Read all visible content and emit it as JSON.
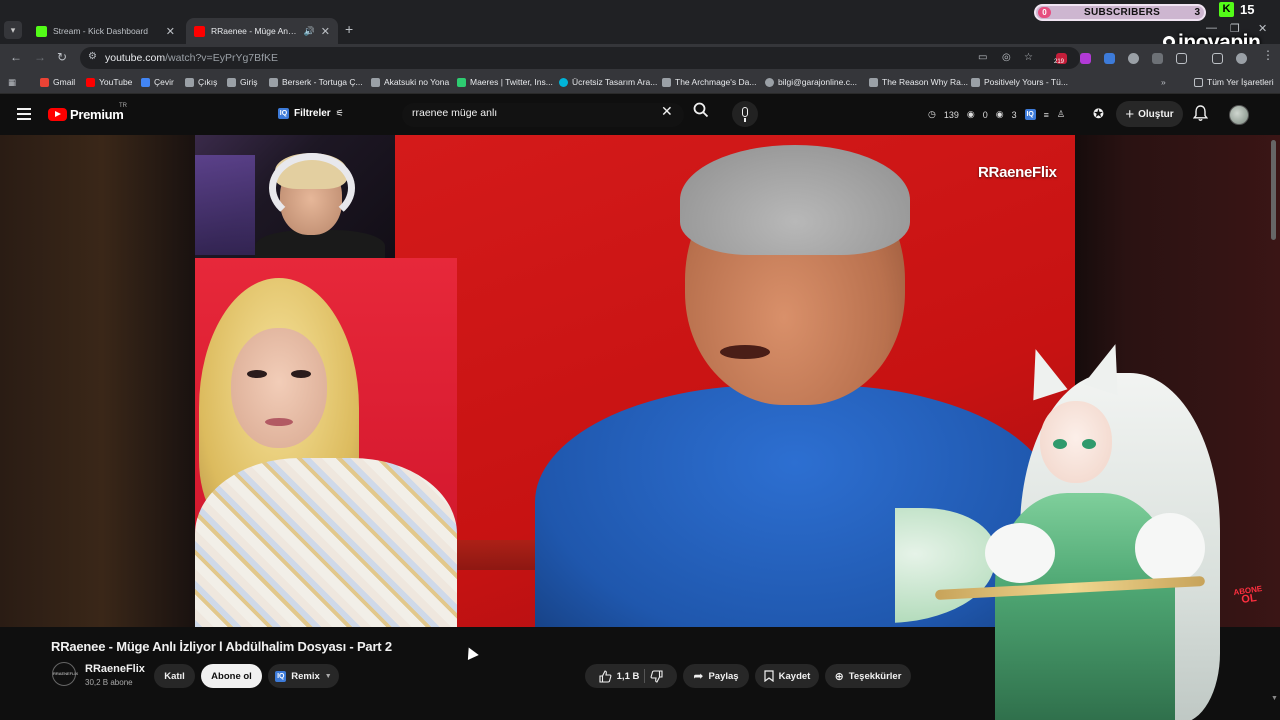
{
  "browser": {
    "tabs": [
      {
        "title": "Stream - Kick Dashboard",
        "favicon_color": "#53fc18",
        "active": false
      },
      {
        "title": "RRaenee - Müge Anlı İzliyor",
        "favicon_color": "#ff0000",
        "active": true
      }
    ],
    "url": "youtube.com/watch?v=EyPrYg7BfKE",
    "url_host": "youtube.com",
    "url_path": "/watch?v=EyPrYg7BfKE",
    "extension_badge": "219",
    "bookmarks": [
      {
        "label": "Gmail",
        "icon_color": "#ea4335"
      },
      {
        "label": "YouTube",
        "icon_color": "#ff0000"
      },
      {
        "label": "Çevir",
        "icon_color": "#4285f4"
      },
      {
        "label": "Çıkış",
        "icon_color": "#9aa0a6"
      },
      {
        "label": "Giriş",
        "icon_color": "#9aa0a6"
      },
      {
        "label": "Berserk - Tortuga Ç...",
        "icon_color": "#9aa0a6"
      },
      {
        "label": "Akatsuki no Yona",
        "icon_color": "#9aa0a6"
      },
      {
        "label": "Maeres | Twitter, Ins...",
        "icon_color": "#2ecc71"
      },
      {
        "label": "Ücretsiz Tasarım Ara...",
        "icon_color": "#00b4d8"
      },
      {
        "label": "The Archmage's Da...",
        "icon_color": "#9aa0a6"
      },
      {
        "label": "bilgi@garajonline.c...",
        "icon_color": "#9aa0a6"
      },
      {
        "label": "The Reason Why Ra...",
        "icon_color": "#9aa0a6"
      },
      {
        "label": "Positively Yours - Tü...",
        "icon_color": "#9aa0a6"
      }
    ],
    "all_bookmarks_label": "Tüm Yer İşaretleri"
  },
  "overlay": {
    "subscribers_label": "SUBSCRIBERS",
    "subscribers_left": "0",
    "subscribers_right": "3",
    "kick_count": "15",
    "watermark": "inovapin",
    "accent_color": "#53fc18"
  },
  "youtube": {
    "logo_text": "Premium",
    "logo_region": "TR",
    "filters_label": "Filtreler",
    "search_query": "rraenee müge anlı",
    "stats": {
      "views": "139",
      "eye": "0",
      "other": "3"
    },
    "create_label": "Oluştur"
  },
  "video": {
    "watermark": "RRaeneFlix",
    "badge_line1": "ABONE",
    "badge_line2": "OL"
  },
  "meta": {
    "title": "RRaenee - Müge Anlı İzliyor l Abdülhalim Dosyası - Part 2",
    "channel_name": "RRaeneFlix",
    "channel_subs": "30,2 B abone",
    "join_label": "Katıl",
    "subscribe_label": "Abone ol",
    "remix_label": "Remix",
    "like_count": "1,1 B",
    "share_label": "Paylaş",
    "save_label": "Kaydet",
    "thanks_label": "Teşekkürler"
  }
}
